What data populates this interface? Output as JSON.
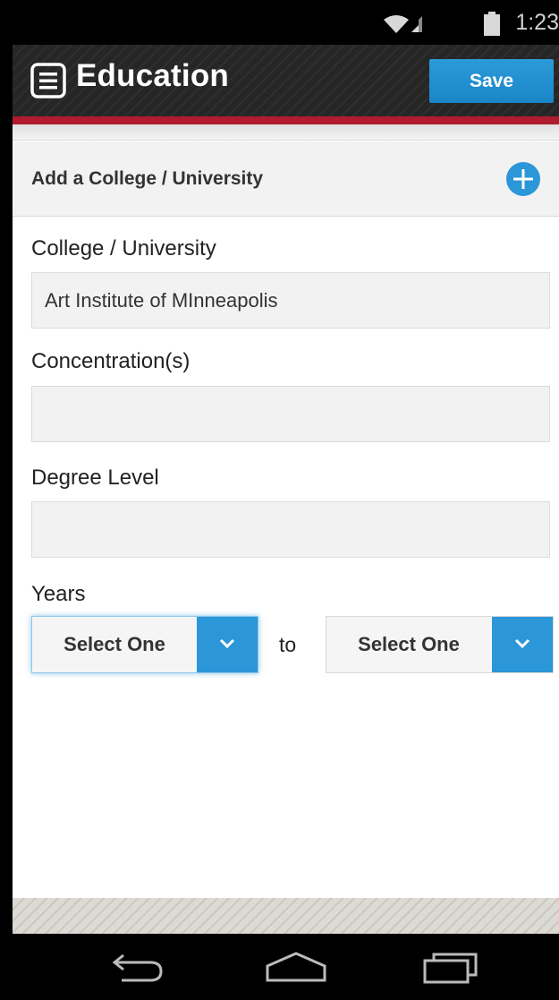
{
  "status_bar": {
    "time": "1:23"
  },
  "header": {
    "title": "Education",
    "save_label": "Save"
  },
  "add_section": {
    "label": "Add a College / University"
  },
  "form": {
    "college": {
      "label": "College / University",
      "value": "Art Institute of MInneapolis"
    },
    "concentration": {
      "label": "Concentration(s)",
      "value": ""
    },
    "degree": {
      "label": "Degree Level",
      "value": ""
    },
    "years": {
      "label": "Years",
      "from_value": "Select One",
      "separator": "to",
      "to_value": "Select One"
    }
  },
  "colors": {
    "accent_blue": "#2b96d8",
    "accent_red": "#b01c2e",
    "action_bar": "#262626"
  },
  "icons": [
    "wifi-icon",
    "signal-icon",
    "battery-icon",
    "menu-icon",
    "plus-icon",
    "chevron-down-icon",
    "back-icon",
    "home-icon",
    "recents-icon"
  ]
}
